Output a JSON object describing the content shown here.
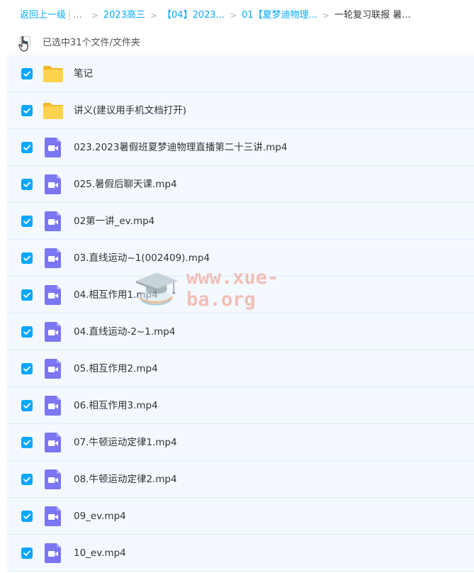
{
  "breadcrumb": {
    "back_label": "返回上一级",
    "ellipsis": "...",
    "items": [
      "2023高三",
      "【04】2023...",
      "01【夏梦迪物理..."
    ],
    "current": "一轮复习联报 暑..."
  },
  "selection": {
    "summary": "已选中31个文件/文件夹"
  },
  "files": [
    {
      "name": "笔记",
      "type": "folder",
      "selected": true
    },
    {
      "name": "讲义(建议用手机文档打开)",
      "type": "folder",
      "selected": true
    },
    {
      "name": "023.2023暑假班夏梦迪物理直播第二十三讲.mp4",
      "type": "video",
      "selected": true
    },
    {
      "name": "025.暑假后聊天课.mp4",
      "type": "video",
      "selected": true
    },
    {
      "name": "02第一讲_ev.mp4",
      "type": "video",
      "selected": true
    },
    {
      "name": "03.直线运动~1(002409).mp4",
      "type": "video",
      "selected": true
    },
    {
      "name": "04.相互作用1.mp4",
      "type": "video",
      "selected": true
    },
    {
      "name": "04.直线运动-2~1.mp4",
      "type": "video",
      "selected": true
    },
    {
      "name": "05.相互作用2.mp4",
      "type": "video",
      "selected": true
    },
    {
      "name": "06.相互作用3.mp4",
      "type": "video",
      "selected": true
    },
    {
      "name": "07.牛顿运动定律1.mp4",
      "type": "video",
      "selected": true
    },
    {
      "name": "08.牛顿运动定律2.mp4",
      "type": "video",
      "selected": true
    },
    {
      "name": "09_ev.mp4",
      "type": "video",
      "selected": true
    },
    {
      "name": "10_ev.mp4",
      "type": "video",
      "selected": true
    }
  ],
  "watermark": {
    "text": "www.xue-ba.org"
  },
  "colors": {
    "accent": "#06a7ff",
    "folder": "#ffd34d",
    "video": "#7b76f2",
    "row_bg": "#f3f9ff",
    "watermark": "#f2a79a"
  }
}
